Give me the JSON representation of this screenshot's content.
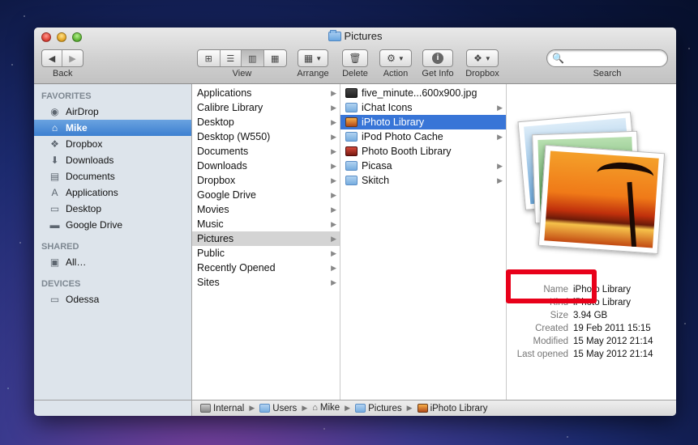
{
  "window": {
    "title": "Pictures"
  },
  "toolbar": {
    "back_label": "Back",
    "view_label": "View",
    "arrange_label": "Arrange",
    "delete_label": "Delete",
    "action_label": "Action",
    "getinfo_label": "Get Info",
    "dropbox_label": "Dropbox",
    "search_label": "Search",
    "search_placeholder": ""
  },
  "sidebar": {
    "favorites_header": "FAVORITES",
    "favorites": [
      {
        "label": "AirDrop",
        "icon": "airdrop-icon"
      },
      {
        "label": "Mike",
        "icon": "home-icon",
        "selected": true
      },
      {
        "label": "Dropbox",
        "icon": "dropbox-icon"
      },
      {
        "label": "Downloads",
        "icon": "downloads-icon"
      },
      {
        "label": "Documents",
        "icon": "documents-icon"
      },
      {
        "label": "Applications",
        "icon": "applications-icon"
      },
      {
        "label": "Desktop",
        "icon": "desktop-icon"
      },
      {
        "label": "Google Drive",
        "icon": "folder-icon"
      }
    ],
    "shared_header": "SHARED",
    "shared": [
      {
        "label": "All…",
        "icon": "network-icon"
      }
    ],
    "devices_header": "DEVICES",
    "devices": [
      {
        "label": "Odessa",
        "icon": "drive-icon"
      }
    ]
  },
  "column1": [
    "Applications",
    "Calibre Library",
    "Desktop",
    "Desktop (W550)",
    "Documents",
    "Downloads",
    "Dropbox",
    "Google Drive",
    "Movies",
    "Music",
    "Pictures",
    "Public",
    "Recently Opened",
    "Sites"
  ],
  "column2": [
    {
      "name": "five_minute...600x900.jpg",
      "type": "img"
    },
    {
      "name": "iChat Icons",
      "type": "folder"
    },
    {
      "name": "iPhoto Library",
      "type": "photo"
    },
    {
      "name": "iPod Photo Cache",
      "type": "folder"
    },
    {
      "name": "Photo Booth Library",
      "type": "booth"
    },
    {
      "name": "Picasa",
      "type": "folder"
    },
    {
      "name": "Skitch",
      "type": "folder"
    }
  ],
  "info": {
    "name_k": "Name",
    "name_v": "iPhoto Library",
    "kind_k": "Kind",
    "kind_v": "iPhoto Library",
    "size_k": "Size",
    "size_v": "3.94 GB",
    "created_k": "Created",
    "created_v": "19 Feb 2011 15:15",
    "modified_k": "Modified",
    "modified_v": "15 May 2012 21:14",
    "opened_k": "Last opened",
    "opened_v": "15 May 2012 21:14"
  },
  "pathbar": [
    "Internal",
    "Users",
    "Mike",
    "Pictures",
    "iPhoto Library"
  ],
  "colors": {
    "selection_blue": "#3875d7",
    "highlight_red": "#e8001a",
    "sidebar_bg": "#dde4eb"
  }
}
